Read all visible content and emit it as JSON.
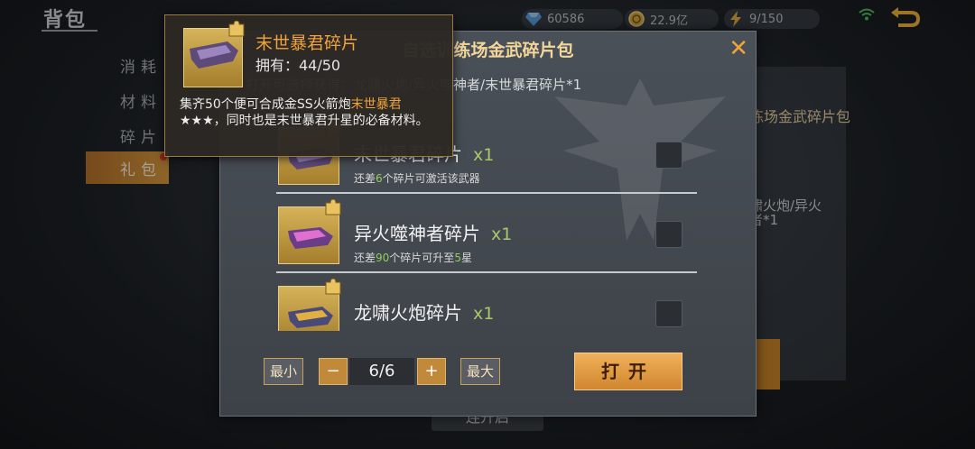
{
  "header": {
    "title": "背包",
    "diamonds": "60586",
    "coins": "22.9亿",
    "energy": "9/150"
  },
  "sidebar": {
    "items": [
      {
        "label": "消耗"
      },
      {
        "label": "材料"
      },
      {
        "label": "碎片"
      },
      {
        "label": "礼包"
      }
    ]
  },
  "background_panel": {
    "item_title": "练场金武碎片包",
    "item_desc": "啸火炮/异火\n者*1",
    "bottom_button": "连开启"
  },
  "dialog": {
    "title": "自选训练场金武碎片包",
    "description": "打开可选择获得：龙啸火炮/异火噬神者/末世暴君碎片*1",
    "items": [
      {
        "name": "末世暴君碎片",
        "qty": "x1",
        "sub_prefix": "还差",
        "sub_num": "6",
        "sub_suffix": "个碎片可激活该武器",
        "sub_num2": "",
        "sub_suffix2": ""
      },
      {
        "name": "异火噬神者碎片",
        "qty": "x1",
        "sub_prefix": "还差",
        "sub_num": "90",
        "sub_suffix": "个碎片可升至",
        "sub_num2": "5",
        "sub_suffix2": "星"
      },
      {
        "name": "龙啸火炮碎片",
        "qty": "x1",
        "sub_prefix": "",
        "sub_num": "",
        "sub_suffix": "",
        "sub_num2": "",
        "sub_suffix2": ""
      }
    ],
    "min_label": "最小",
    "minus_label": "−",
    "quantity": "6/6",
    "plus_label": "+",
    "max_label": "最大",
    "open_label": "打开"
  },
  "tooltip": {
    "name": "末世暴君碎片",
    "owned": "拥有：44/50",
    "desc_prefix": "集齐50个便可合成金SS火箭炮",
    "desc_highlight": "末世暴君",
    "desc_suffix": "★★★，同时也是末世暴君升星的必备材料。"
  },
  "colors": {
    "accent_orange": "#f0a33a",
    "highlight_green": "#8fd05c",
    "gold_frame": "#d6b35a"
  }
}
